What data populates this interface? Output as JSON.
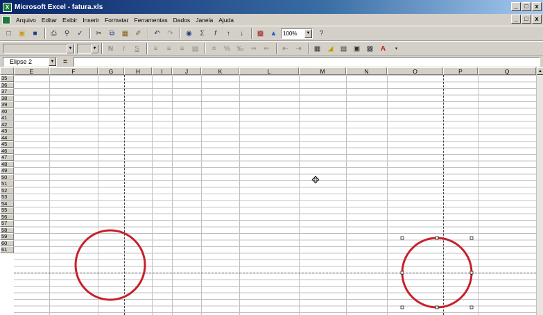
{
  "window": {
    "title": "Microsoft Excel - fatura.xls",
    "logo_letter": "X"
  },
  "window_buttons": [
    "_",
    "□",
    "x"
  ],
  "doc_buttons": [
    "_",
    "□",
    "x"
  ],
  "menu": {
    "items": [
      "Arquivo",
      "Editar",
      "Exibir",
      "Inserir",
      "Formatar",
      "Ferramentas",
      "Dados",
      "Janela",
      "Ajuda"
    ]
  },
  "standard_toolbar": {
    "zoom": "100%"
  },
  "formula_bar": {
    "name_box": "Elipse 2",
    "equals": "=",
    "value": ""
  },
  "grid": {
    "columns": [
      "E",
      "F",
      "G",
      "H",
      "I",
      "J",
      "K",
      "L",
      "M",
      "N",
      "O",
      "P",
      "Q"
    ],
    "rows": [
      "35",
      "36",
      "37",
      "38",
      "39",
      "40",
      "41",
      "42",
      "43",
      "44",
      "45",
      "46",
      "47",
      "48",
      "49",
      "50",
      "51",
      "52",
      "53",
      "54",
      "55",
      "56",
      "57",
      "58",
      "59",
      "60",
      "61"
    ]
  },
  "shapes": {
    "ellipse_color": "#c8202a",
    "selected_shape": "Elipse 2"
  }
}
